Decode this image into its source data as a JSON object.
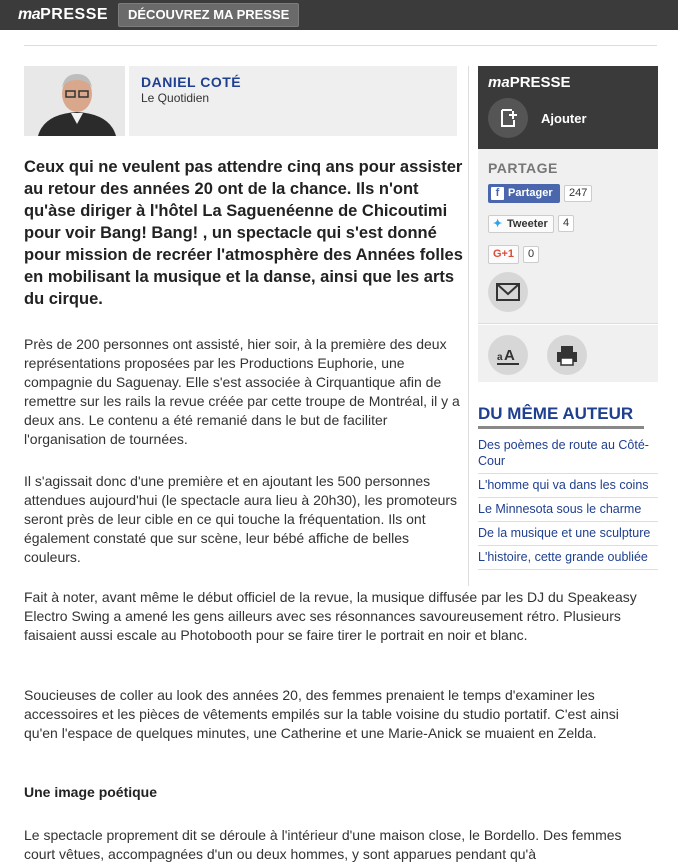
{
  "topbar": {
    "logo_ma": "ma",
    "logo_presse": "PRESSE",
    "discover": "DÉCOUVREZ MA PRESSE"
  },
  "author": {
    "name": "DANIEL COTÉ",
    "org": "Le Quotidien"
  },
  "article": {
    "lead": "Ceux qui ne veulent pas attendre cinq ans pour assister au retour des années 20 ont de la chance. Ils n'ont qu'àse diriger à l'hôtel La Saguenéenne de Chicoutimi pour voir Bang! Bang! , un spectacle qui s'est donné pour mission de recréer l'atmosphère des Années folles en mobilisant la musique et la danse, ainsi que les arts du cirque.",
    "paragraphs": [
      "Près de 200 personnes ont assisté, hier soir, à la première des deux représentations proposées par les Productions Euphorie, une compagnie du Saguenay. Elle s'est associée à Cirquantique afin de remettre sur les rails la revue créée par cette troupe de Montréal, il y a deux ans. Le contenu a été remanié dans le but de faciliter l'organisation de tournées.",
      "Il s'agissait donc d'une première et en ajoutant les 500 personnes attendues aujourd'hui (le spectacle aura lieu à 20h30), les promoteurs seront près de leur cible en ce qui touche la fréquentation. Ils ont également constaté que sur scène, leur bébé affiche de belles couleurs.",
      "Fait à noter, avant même le début officiel de la revue, la musique diffusée par les DJ du Speakeasy Electro Swing a amené les gens ailleurs avec ses résonnances savoureusement rétro. Plusieurs faisaient aussi escale au Photobooth pour se faire tirer le portrait en noir et blanc.",
      "Soucieuses de coller au look des années 20, des femmes prenaient le temps d'examiner les accessoires et les pièces de vêtements empilés sur la table voisine du studio portatif. C'est ainsi qu'en l'espace de quelques minutes, une Catherine et une Marie-Anick se muaient en Zelda.",
      "Le spectacle proprement dit se déroule à l'intérieur d'une maison close, le Bordello. Des femmes court vêtues, accompagnées d'un ou deux hommes, y sont apparues pendant qu'à"
    ],
    "subhead": "Une image poétique"
  },
  "sidebar": {
    "logo_ma": "ma",
    "logo_presse": "PRESSE",
    "add_label": "Ajouter",
    "share_title": "PARTAGE",
    "facebook_label": "Partager",
    "facebook_count": "247",
    "twitter_label": "Tweeter",
    "twitter_count": "4",
    "gplus_label": "G+1",
    "gplus_count": "0",
    "same_author_title": "DU MÊME AUTEUR",
    "same_author_links": [
      "Des poèmes de route au Côté-Cour",
      "L'homme qui va dans les coins",
      "Le Minnesota sous le charme",
      "De la musique et une sculpture",
      "L'histoire, cette grande oubliée"
    ]
  }
}
